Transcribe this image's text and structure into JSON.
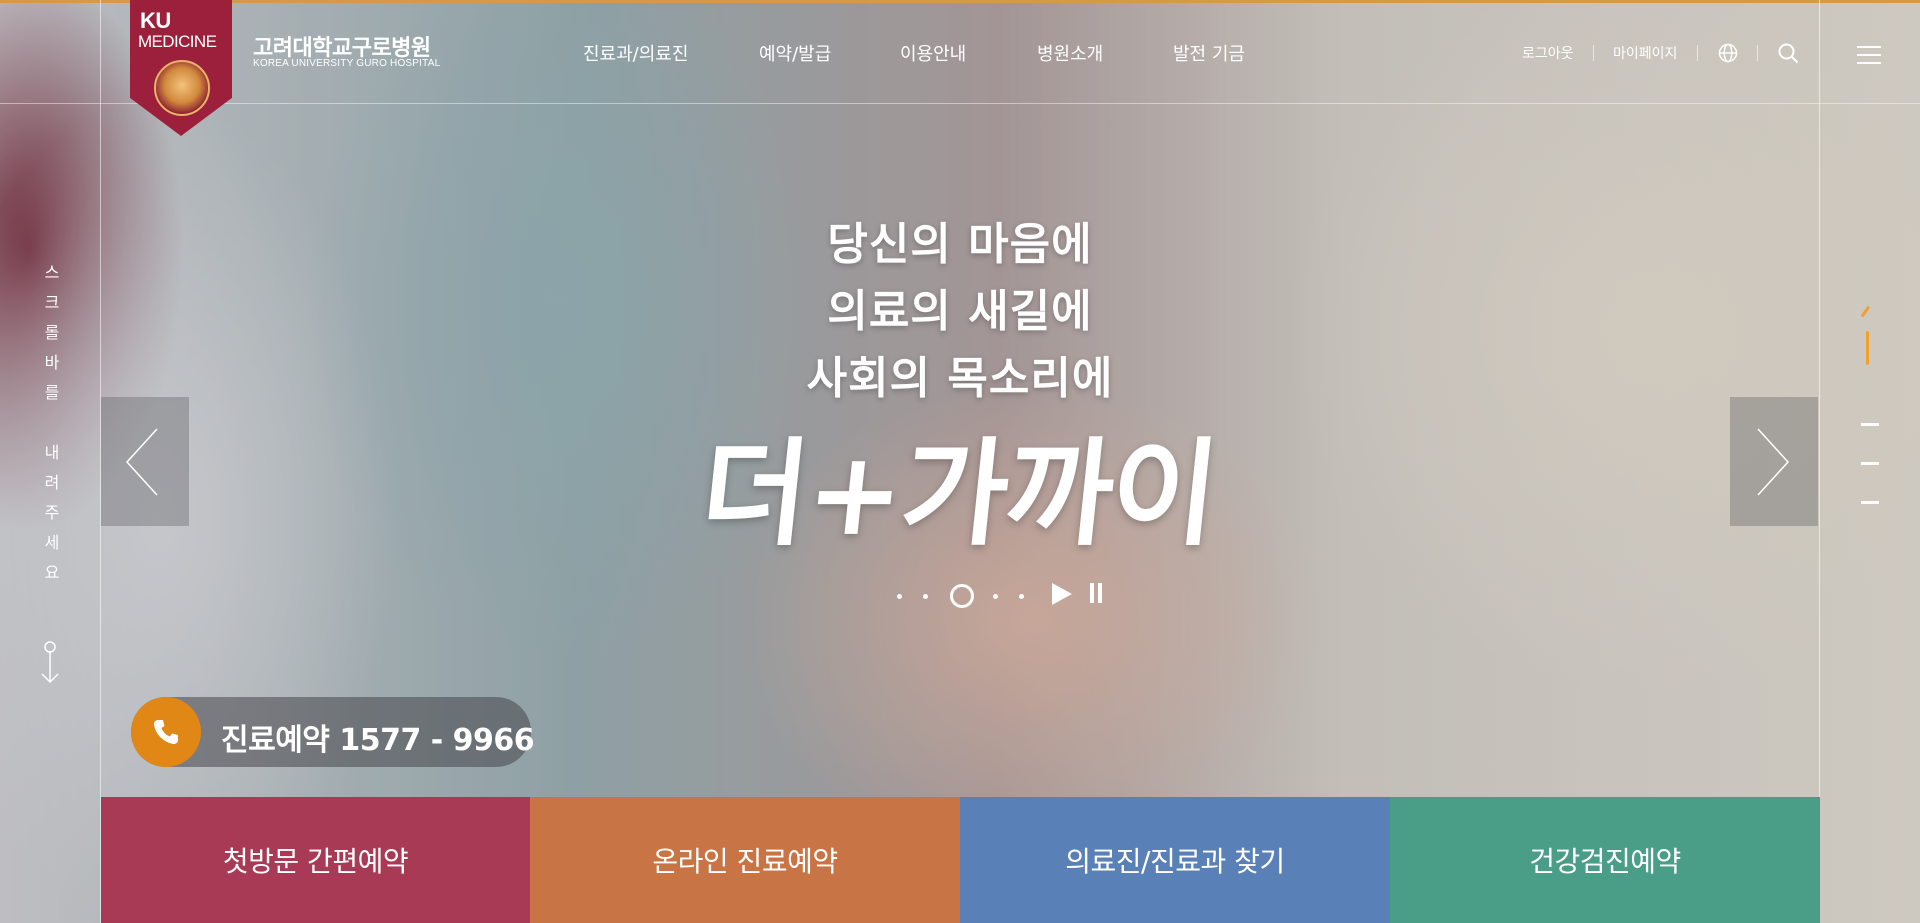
{
  "header": {
    "logo": {
      "top": "KU",
      "bottom": "MEDICINE"
    },
    "hospital_name": "고려대학교구로병원",
    "hospital_name_en": "KOREA UNIVERSITY GURO HOSPITAL",
    "nav": [
      "진료과/의료진",
      "예약/발급",
      "이용안내",
      "병원소개",
      "발전 기금"
    ],
    "utility": {
      "logout": "로그아웃",
      "mypage": "마이페이지"
    },
    "icons": {
      "language": "globe-icon",
      "search": "search-icon",
      "menu": "hamburger-menu-icon"
    }
  },
  "side": {
    "scroll_hint": [
      "스",
      "크",
      "롤",
      "바",
      "를",
      "",
      "내",
      "려",
      "주",
      "세",
      "요"
    ]
  },
  "hero": {
    "lines": [
      "당신의 마음에",
      "의료의 새길에",
      "사회의 목소리에"
    ],
    "brush_title": "더+가까이",
    "slides": {
      "count": 5,
      "active_index": 2
    }
  },
  "reservation": {
    "label": "진료예약 1577 - 9966",
    "icon": "phone-icon"
  },
  "quick_links": [
    {
      "label": "첫방문 간편예약",
      "color": "#a83a55"
    },
    {
      "label": "온라인 진료예약",
      "color": "#c87444"
    },
    {
      "label": "의료진/진료과 찾기",
      "color": "#5a80b8"
    },
    {
      "label": "건강검진예약",
      "color": "#4a9e88"
    }
  ],
  "colors": {
    "accent": "#d39a4a",
    "brand": "#9c1f3b",
    "phone": "#e08716"
  }
}
